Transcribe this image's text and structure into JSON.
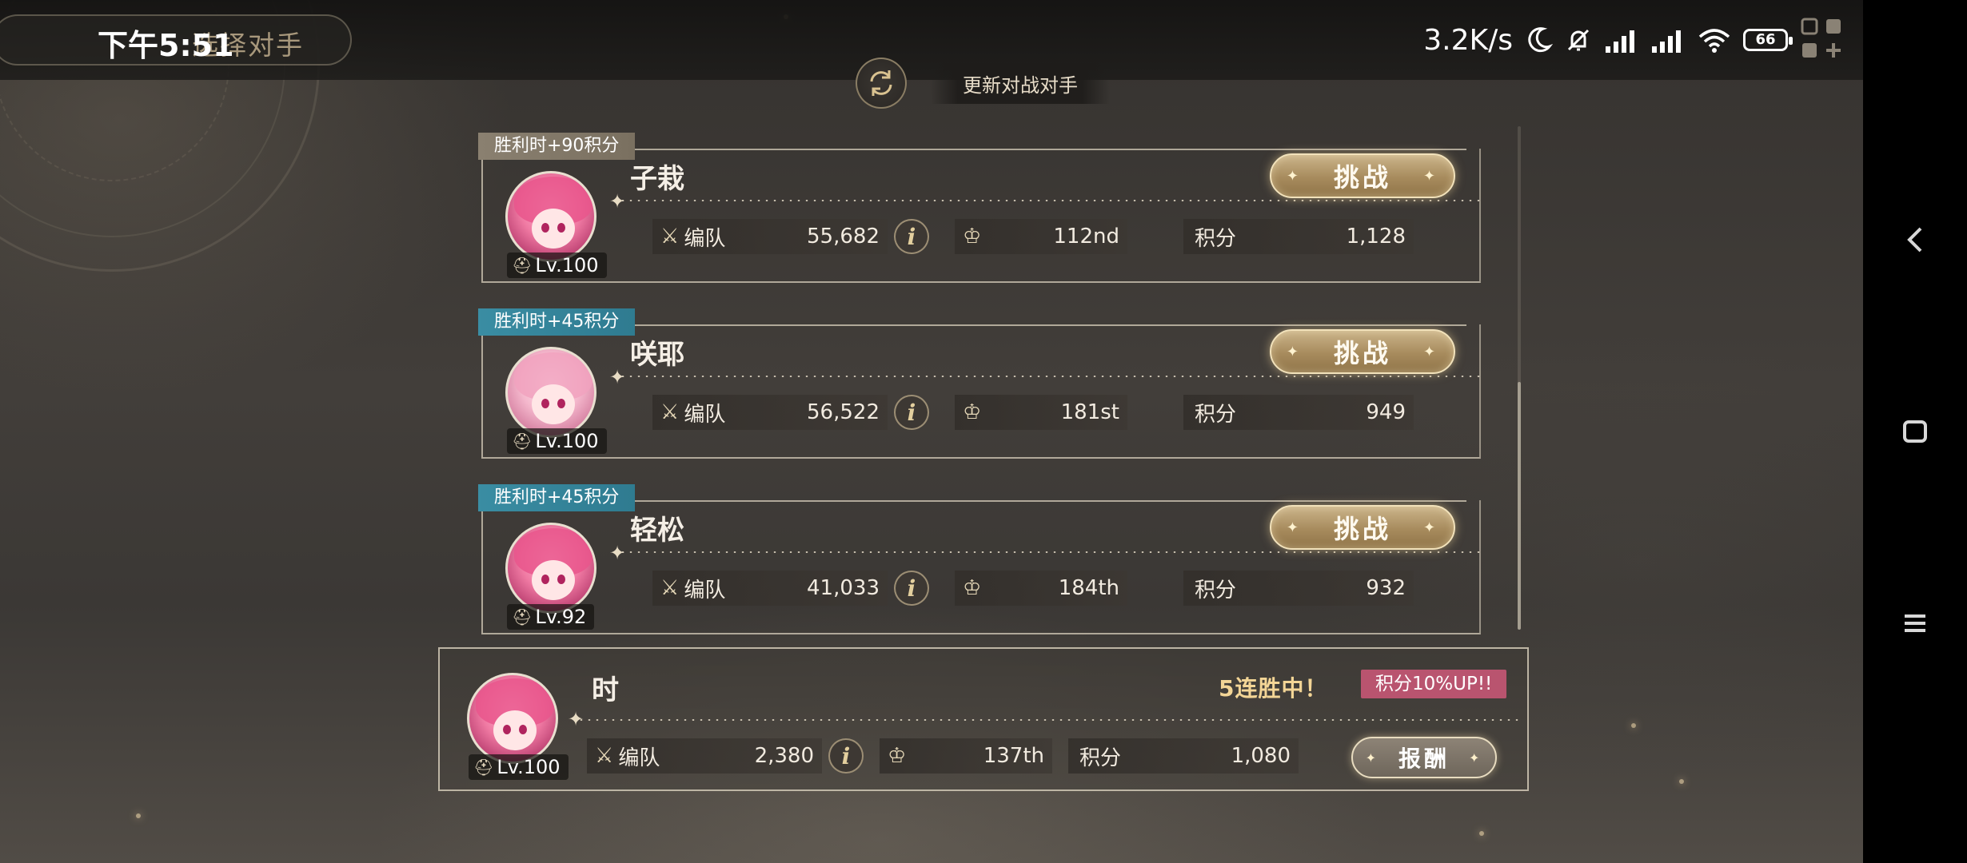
{
  "status_bar": {
    "time": "下午5:51",
    "speed": "3.2K/s",
    "battery": "66"
  },
  "header": {
    "screen_title": "选择对手"
  },
  "refresh": {
    "label": "更新对战对手"
  },
  "stat_labels": {
    "team": "编队",
    "score": "积分",
    "challenge": "挑战",
    "info": "i"
  },
  "opponents": [
    {
      "tag": "胜利时+90积分",
      "tag_color": "#857b6b",
      "name": "子栽",
      "level": "Lv.100",
      "team_power": "55,682",
      "rank": "112nd",
      "score": "1,128"
    },
    {
      "tag": "胜利时+45积分",
      "tag_color": "#3588a0",
      "name": "咲耶",
      "level": "Lv.100",
      "team_power": "56,522",
      "rank": "181st",
      "score": "949"
    },
    {
      "tag": "胜利时+45积分",
      "tag_color": "#3588a0",
      "name": "轻松",
      "level": "Lv.92",
      "team_power": "41,033",
      "rank": "184th",
      "score": "932"
    }
  ],
  "player": {
    "name": "时",
    "level": "Lv.100",
    "streak": "5连胜中！",
    "bonus": "积分10%UP!!",
    "team_power": "2,380",
    "rank": "137th",
    "score": "1,080",
    "reward_label": "报酬"
  },
  "icons": {
    "team": "crossed-swords-icon",
    "rank": "crown-icon",
    "refresh": "refresh-icon",
    "level": "helmet-icon"
  },
  "colors": {
    "challenge_button": "#b09566",
    "bonus_badge": "#b9546f",
    "streak_text": "#f3d596"
  }
}
